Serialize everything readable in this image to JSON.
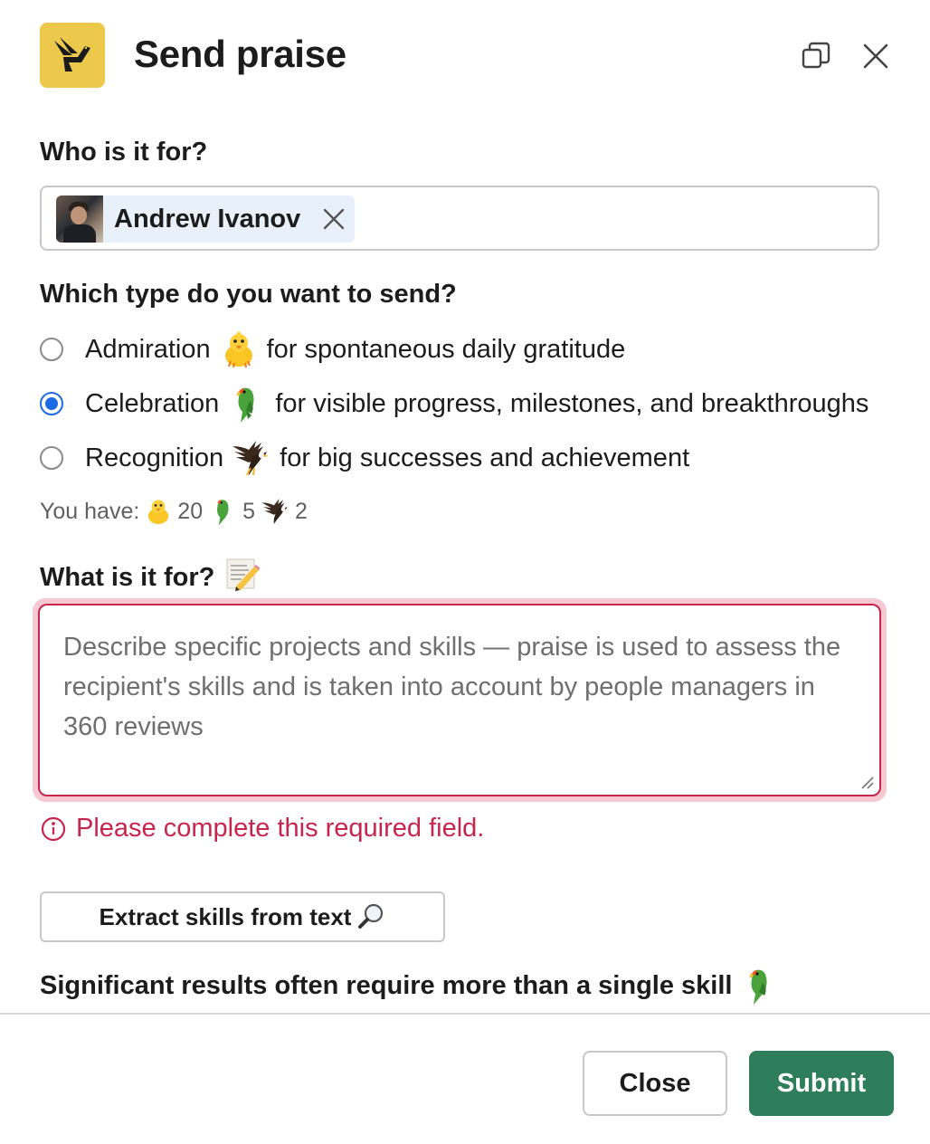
{
  "header": {
    "title": "Send praise",
    "logo_icon": "bird-logo-icon",
    "accent_color": "#ecc94b"
  },
  "recipient": {
    "label": "Who is it for?",
    "selected_user": "Andrew Ivanov"
  },
  "praise_type": {
    "label": "Which type do you want to send?",
    "options": [
      {
        "name": "Admiration",
        "emoji": "chick-emoji",
        "description": "for spontaneous daily gratitude",
        "selected": false
      },
      {
        "name": "Celebration",
        "emoji": "parrot-emoji",
        "description": "for visible progress, milestones, and breakthroughs",
        "selected": true
      },
      {
        "name": "Recognition",
        "emoji": "eagle-emoji",
        "description": "for big successes and achievement",
        "selected": false
      }
    ]
  },
  "balance": {
    "prefix": "You have:",
    "admiration": "20",
    "celebration": "5",
    "recognition": "2"
  },
  "description": {
    "label": "What is it for?",
    "placeholder": "Describe specific projects and skills — praise is used to assess the recipient's skills and is taken into account by people managers in 360 reviews",
    "error": "Please complete this required field.",
    "error_color": "#c8254e"
  },
  "skills": {
    "extract_button": "Extract skills from text",
    "hint": "Significant results often require more than a single skill"
  },
  "footer": {
    "close_label": "Close",
    "submit_label": "Submit",
    "submit_color": "#2e7d5b"
  }
}
